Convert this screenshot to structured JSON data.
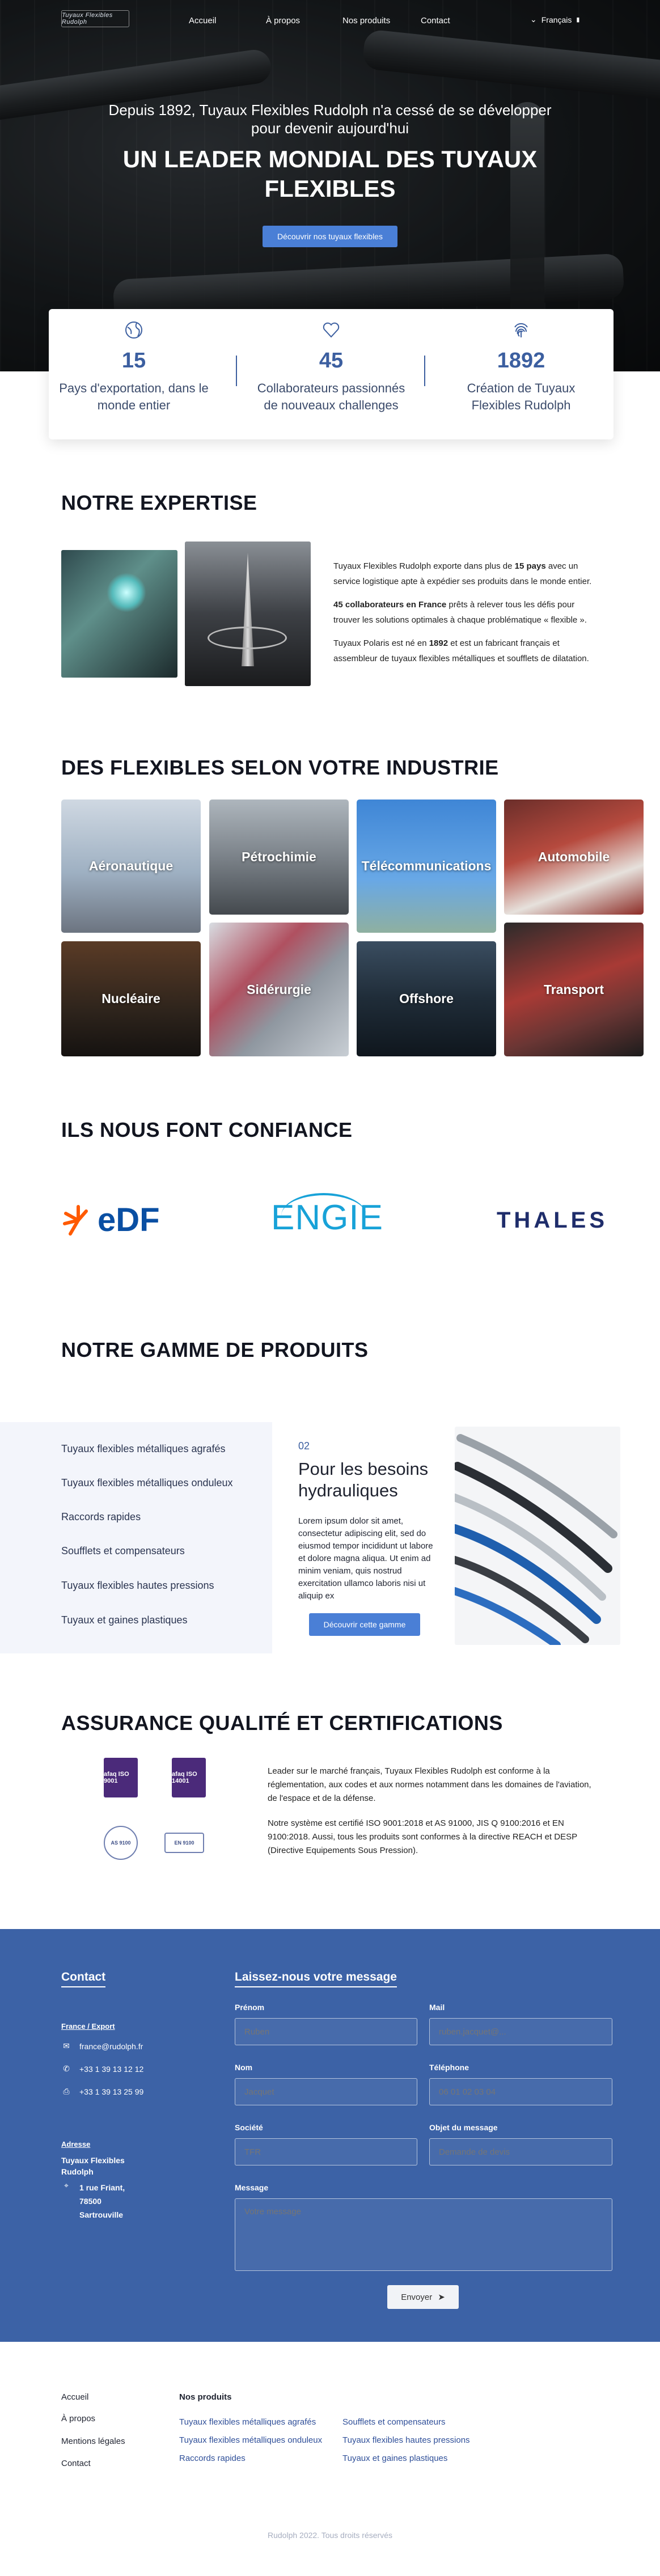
{
  "nav": {
    "logo": "Tuyaux Flexibles Rudolph",
    "items": [
      "Accueil",
      "À propos",
      "Nos produits",
      "Contact"
    ],
    "language": "Français"
  },
  "hero": {
    "subtitle_line1": "Depuis 1892, Tuyaux Flexibles Rudolph n'a cessé de se développer",
    "subtitle_line2": "pour devenir aujourd'hui",
    "title_line1": "UN LEADER MONDIAL DES TUYAUX",
    "title_line2": "FLEXIBLES",
    "button": "Découvrir nos tuyaux flexibles"
  },
  "stats": [
    {
      "icon": "globe-icon",
      "value": "15",
      "label_line1": "Pays d'exportation, dans le",
      "label_line2": "monde entier"
    },
    {
      "icon": "heart-icon",
      "value": "45",
      "label_line1": "Collaborateurs passionnés",
      "label_line2": "de nouveaux challenges"
    },
    {
      "icon": "fingerprint-icon",
      "value": "1892",
      "label_line1": "Création de Tuyaux",
      "label_line2": "Flexibles Rudolph"
    }
  ],
  "expertise": {
    "heading": "NOTRE EXPERTISE",
    "p1_a": "Tuyaux Flexibles Rudolph exporte dans plus de ",
    "p1_b": "15 pays",
    "p1_c": " avec un service logistique apte à expédier ses produits dans le monde entier.",
    "p2_a": "45 collaborateurs en France",
    "p2_b": " prêts à relever tous les défis pour trouver les solutions optimales à chaque problématique « flexible ».",
    "p3_a": "Tuyaux Polaris est né en ",
    "p3_b": "1892",
    "p3_c": " et est un fabricant français et assembleur de tuyaux flexibles métalliques et soufflets de dilatation."
  },
  "industries": {
    "heading": "DES FLEXIBLES SELON VOTRE INDUSTRIE",
    "items": [
      "Aéronautique",
      "Pétrochimie",
      "Télécommunications",
      "Automobile",
      "Nucléaire",
      "Sidérurgie",
      "Offshore",
      "Transport"
    ]
  },
  "trust": {
    "heading": "ILS NOUS FONT CONFIANCE",
    "logos": [
      "eDF",
      "ENGIE",
      "THALES"
    ]
  },
  "products": {
    "heading": "NOTRE GAMME DE PRODUITS",
    "items": [
      "Tuyaux flexibles métalliques agrafés",
      "Tuyaux flexibles métalliques onduleux",
      "Raccords rapides",
      "Soufflets et compensateurs",
      "Tuyaux flexibles hautes pressions",
      "Tuyaux et gaines plastiques"
    ],
    "active_number": "02",
    "active_title_line1": "Pour les besoins",
    "active_title_line2": "hydrauliques",
    "active_desc": "Lorem ipsum dolor sit amet, consectetur adipiscing elit, sed do eiusmod tempor incididunt ut labore et dolore magna aliqua. Ut enim ad minim veniam, quis nostrud exercitation ullamco laboris nisi ut aliquip ex",
    "button": "Découvrir cette gamme"
  },
  "quality": {
    "heading": "ASSURANCE QUALITÉ ET CERTIFICATIONS",
    "certs": [
      "afaq ISO 9001",
      "afaq ISO 14001",
      "AS 9100",
      "EN 9100"
    ],
    "p1": "Leader sur le marché français, Tuyaux Flexibles Rudolph est conforme à la réglementation, aux codes et aux normes notamment dans les domaines de l'aviation, de l'espace et de la défense.",
    "p2": "Notre système est certifié ISO 9001:2018 et AS 91000, JIS Q 9100:2016 et EN 9100:2018. Aussi, tous les produits sont conformes à la directive REACH et DESP (Directive Equipements Sous Pression)."
  },
  "contact": {
    "heading": "Contact",
    "export_label": "France / Export",
    "email": "france@rudolph.fr",
    "phone": "+33 1 39 13 12 12",
    "fax": "+33 1 39 13 25 99",
    "address_label": "Adresse",
    "company_line1": "Tuyaux Flexibles",
    "company_line2": "Rudolph",
    "street": "1 rue Friant,",
    "zip": "78500",
    "city": "Sartrouville",
    "form_heading": "Laissez-nous votre message",
    "fields": {
      "prenom_label": "Prénom",
      "prenom_ph": "Ruben",
      "mail_label": "Mail",
      "mail_ph": "ruben.jacquet@...",
      "nom_label": "Nom",
      "nom_ph": "Jacquet",
      "tel_label": "Téléphone",
      "tel_ph": "06 01 02 03 04",
      "societe_label": "Société",
      "societe_ph": "TFR",
      "objet_label": "Objet du message",
      "objet_ph": "Demande de devis",
      "message_label": "Message",
      "message_ph": "Votre message"
    },
    "send": "Envoyer"
  },
  "footer": {
    "links": [
      "Accueil",
      "À propos",
      "Mentions légales",
      "Contact"
    ],
    "products_heading": "Nos produits",
    "products_col1": [
      "Tuyaux flexibles métalliques agrafés",
      "Tuyaux flexibles métalliques onduleux",
      "Raccords rapides"
    ],
    "products_col2": [
      "Soufflets et compensateurs",
      "Tuyaux flexibles hautes pressions",
      "Tuyaux et gaines plastiques"
    ],
    "copyright": "Rudolph 2022. Tous droits réservés"
  },
  "colors": {
    "brand_blue": "#3c62a6",
    "accent": "#4a7fd6"
  }
}
